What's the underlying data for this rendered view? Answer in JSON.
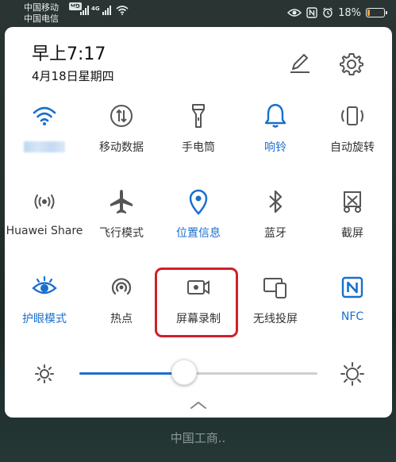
{
  "status_bar": {
    "carrier_1": "中国移动",
    "carrier_1_badge": "HD",
    "carrier_2": "中国电信",
    "network_1": "4G",
    "network_2": "4G",
    "battery_percent": "18%",
    "battery_level": 0.18,
    "icons": [
      "eye-icon",
      "nfc-icon",
      "alarm-icon",
      "battery-icon"
    ]
  },
  "header": {
    "time": "早上7:17",
    "date": "4月18日星期四",
    "edit_icon": "pen-icon",
    "settings_icon": "gear-icon"
  },
  "tiles": [
    {
      "label": "",
      "icon": "wifi-icon",
      "active": true,
      "label_blurred": true
    },
    {
      "label": "移动数据",
      "icon": "mobile-data-icon",
      "active": false
    },
    {
      "label": "手电筒",
      "icon": "flashlight-icon",
      "active": false
    },
    {
      "label": "响铃",
      "icon": "bell-icon",
      "active": true
    },
    {
      "label": "自动旋转",
      "icon": "auto-rotate-icon",
      "active": false
    },
    {
      "label": "Huawei Share",
      "icon": "huawei-share-icon",
      "active": false
    },
    {
      "label": "飞行模式",
      "icon": "airplane-icon",
      "active": false
    },
    {
      "label": "位置信息",
      "icon": "location-icon",
      "active": true
    },
    {
      "label": "蓝牙",
      "icon": "bluetooth-icon",
      "active": false
    },
    {
      "label": "截屏",
      "icon": "screenshot-icon",
      "active": false
    },
    {
      "label": "护眼模式",
      "icon": "eye-comfort-icon",
      "active": true
    },
    {
      "label": "热点",
      "icon": "hotspot-icon",
      "active": false
    },
    {
      "label": "屏幕录制",
      "icon": "screen-record-icon",
      "active": false,
      "highlighted": true
    },
    {
      "label": "无线投屏",
      "icon": "wireless-projection-icon",
      "active": false
    },
    {
      "label": "NFC",
      "icon": "nfc-tile-icon",
      "active": true
    }
  ],
  "brightness": {
    "level": 0.44,
    "low_icon": "sun-low-icon",
    "high_icon": "sun-high-icon"
  },
  "bottom_text": "中国工商..",
  "colors": {
    "accent": "#1a6fce",
    "inactive_icon": "#555555",
    "highlight_border": "#d02028",
    "panel": "#ffffff"
  }
}
